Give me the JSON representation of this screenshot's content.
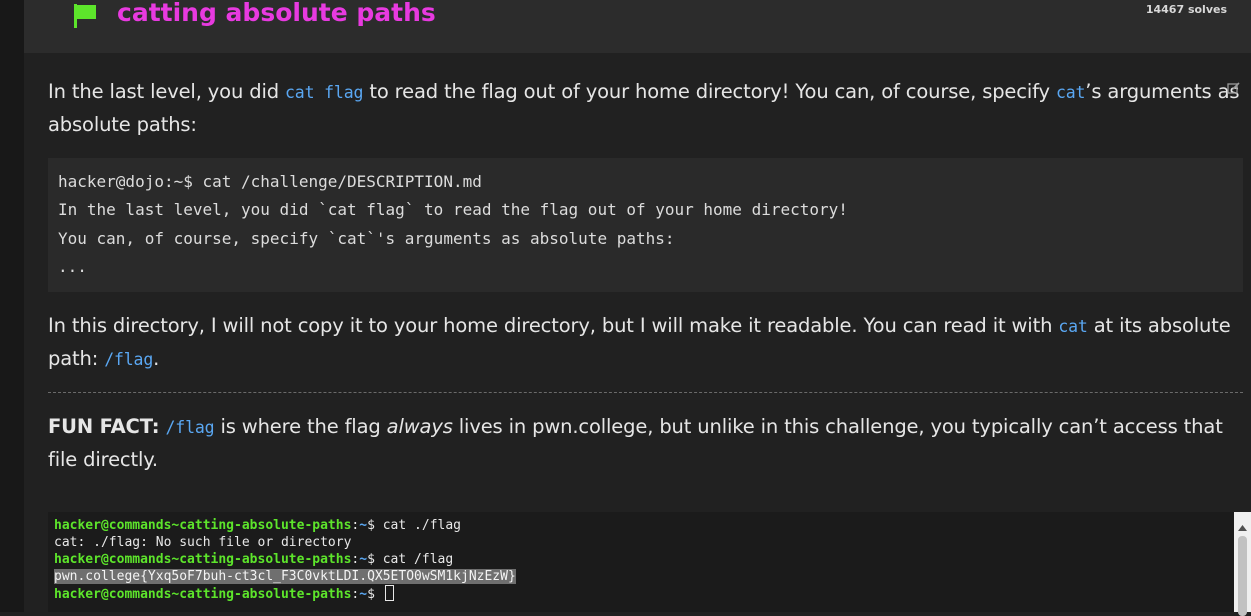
{
  "header": {
    "title": "catting absolute paths",
    "solves": "14467 solves",
    "flag_icon_color": "#5de52b"
  },
  "description": {
    "p1": {
      "t1": "In the last level, you did ",
      "c1": "cat flag",
      "t2": " to read the flag out of your home directory! You can, of course, specify ",
      "c2": "cat",
      "t3": "’s arguments as absolute paths:"
    },
    "code_block": [
      "hacker@dojo:~$ cat /challenge/DESCRIPTION.md",
      "In the last level, you did `cat flag` to read the flag out of your home directory!",
      "You can, of course, specify `cat`'s arguments as absolute paths:",
      "..."
    ],
    "p2": {
      "t1": "In this directory, I will not copy it to your home directory, but I will make it readable. You can read it with ",
      "c1": "cat",
      "t2": " at its absolute path: ",
      "c2": "/flag",
      "t3": "."
    },
    "p3": {
      "bold": "FUN FACT:",
      "t0": " ",
      "c1": "/flag",
      "t1": " is where the flag ",
      "em": "always",
      "t2": " lives in pwn.college, but unlike in this challenge, you typically can’t access that file directly."
    }
  },
  "terminal": {
    "prompt_user": "hacker@commands~catting-absolute-paths",
    "prompt_sep": ":",
    "prompt_path": "~",
    "prompt_end": "$ ",
    "lines": [
      {
        "cmd": "cat ./flag"
      },
      {
        "out": "cat: ./flag: No such file or directory"
      },
      {
        "cmd": "cat /flag"
      },
      {
        "out": "pwn.college{Yxq5oF7buh-ct3cl_F3C0vktLDI.QX5ETO0wSM1kjNzEzW}"
      },
      {
        "cmd": ""
      }
    ]
  },
  "colors": {
    "title": "#e83ae0",
    "code_inline": "#5aa7f2",
    "prompt": "#5de52b"
  }
}
